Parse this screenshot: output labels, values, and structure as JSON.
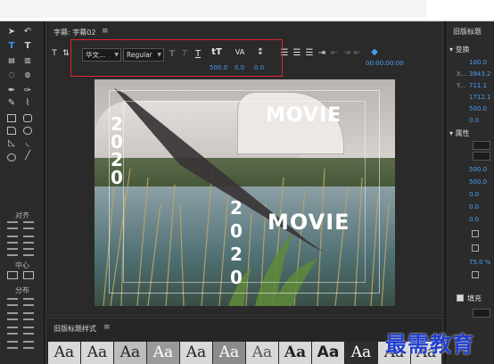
{
  "panel": {
    "title": "字幕: 字幕02",
    "menu": "≡"
  },
  "toolbar": {
    "font_family": "华文...",
    "font_style": "Regular",
    "font_size": "500.0",
    "kerning": "0.0",
    "leading": "0.0",
    "timecode": "00:00:00:00"
  },
  "left_panel": {
    "align_label": "对齐",
    "center_label": "中心",
    "distribute_label": "分布"
  },
  "canvas": {
    "movie_top": "MOVIE",
    "movie_bottom": "MOVIE",
    "vertical_top": [
      "2",
      "0",
      "2",
      "0"
    ],
    "vertical_bottom": [
      "2",
      "0",
      "2",
      "0"
    ]
  },
  "right_panel": {
    "title": "旧版标题",
    "transform_label": "变换",
    "transform_rows": [
      {
        "label": "",
        "value": "100.0"
      },
      {
        "label": "X...",
        "value": "3943.2"
      },
      {
        "label": "Y...",
        "value": "711.1"
      },
      {
        "label": "",
        "value": "1712.1"
      },
      {
        "label": "",
        "value": "500.0"
      },
      {
        "label": "",
        "value": "0.0"
      }
    ],
    "properties_label": "属性",
    "properties_rows": [
      {
        "value": "500.0"
      },
      {
        "value": "500.0"
      },
      {
        "value": "0.0"
      },
      {
        "value": "0.0"
      },
      {
        "value": "0.0"
      }
    ],
    "percent": "75.0 %",
    "fill_label": "填充"
  },
  "styles": {
    "title": "旧版标题样式",
    "menu": "≡",
    "swatch_label": "Aa",
    "swatches": [
      "Aa",
      "Aa",
      "Aa",
      "Aa",
      "Aa",
      "Aa",
      "Aa",
      "Aa",
      "Aa",
      "Aa",
      "Aa",
      "Aa"
    ]
  },
  "watermark": "最需教育",
  "colors": {
    "accent": "#4a9ff5",
    "highlight_box": "#e0262b",
    "watermark": "#1f3ecf"
  }
}
